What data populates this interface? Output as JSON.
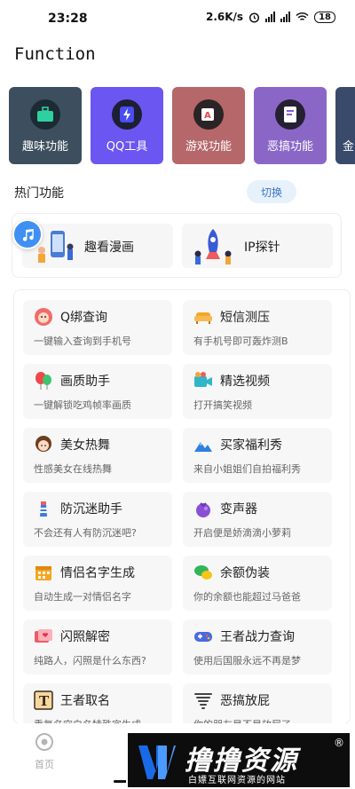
{
  "status_bar": {
    "time": "23:28",
    "net_speed": "2.6K/s",
    "battery": "18"
  },
  "app_bar": {
    "title": "Function"
  },
  "categories": [
    {
      "label": "趣味功能",
      "color": "#3d4f5e"
    },
    {
      "label": "QQ工具",
      "color": "#6b56f2"
    },
    {
      "label": "游戏功能",
      "color": "#b5676a"
    },
    {
      "label": "恶搞功能",
      "color": "#8a67c7"
    },
    {
      "label": "金",
      "color": "#3a4a6a"
    }
  ],
  "hot": {
    "title": "热门功能",
    "switch_label": "切换",
    "items": [
      {
        "label": "趣看漫画"
      },
      {
        "label": "IP探针"
      }
    ]
  },
  "features": [
    {
      "title": "Q绑查询",
      "subtitle": "一键输入查询到手机号",
      "icon": "face-icon"
    },
    {
      "title": "短信测压",
      "subtitle": "有手机号即可轰炸测B",
      "icon": "sofa-icon"
    },
    {
      "title": "画质助手",
      "subtitle": "一键解锁吃鸡帧率画质",
      "icon": "balloon-icon"
    },
    {
      "title": "精选视频",
      "subtitle": "打开搞笑视频",
      "icon": "video-icon"
    },
    {
      "title": "美女热舞",
      "subtitle": "性感美女在线热舞",
      "icon": "girl-icon"
    },
    {
      "title": "买家福利秀",
      "subtitle": "来自小姐姐们自拍福利秀",
      "icon": "mountain-icon"
    },
    {
      "title": "防沉迷助手",
      "subtitle": "不会还有人有防沉迷吧?",
      "icon": "lighthouse-icon"
    },
    {
      "title": "变声器",
      "subtitle": "开启便是娇滴滴小萝莉",
      "icon": "bag-icon"
    },
    {
      "title": "情侣名字生成",
      "subtitle": "自动生成一对情侣名字",
      "icon": "calendar-icon"
    },
    {
      "title": "余额伪装",
      "subtitle": "你的余额也能超过马爸爸",
      "icon": "chat-icon"
    },
    {
      "title": "闪照解密",
      "subtitle": "纯路人，闪照是什么东西?",
      "icon": "heart-mail-icon"
    },
    {
      "title": "王者战力查询",
      "subtitle": "使用后国服永远不再是梦",
      "icon": "gamepad-icon"
    },
    {
      "title": "王者取名",
      "subtitle": "重复名空白名特殊字生成",
      "icon": "text-icon"
    },
    {
      "title": "恶搞放屁",
      "subtitle": "你的朋友是不是放屁了",
      "icon": "tornado-icon"
    }
  ],
  "bottom_nav": {
    "home_label": "首页"
  },
  "watermark": {
    "title": "撸撸资源",
    "subtitle": "白嫖互联网资源的网站",
    "reg": "®"
  }
}
